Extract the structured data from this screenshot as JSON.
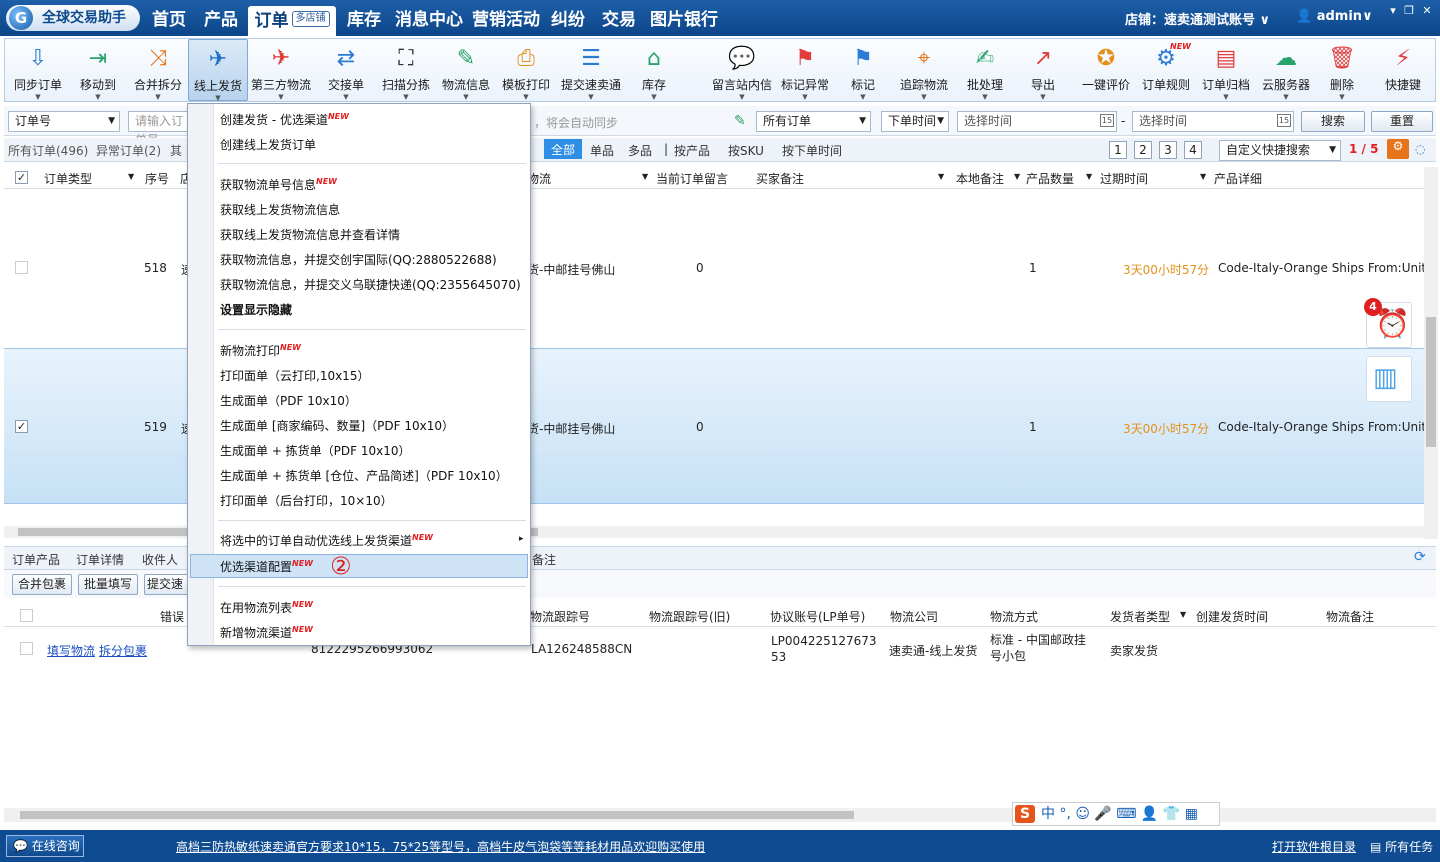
{
  "app": {
    "logo": "全球交易助手",
    "logo_glyph": "G"
  },
  "nav": {
    "items": [
      "首页",
      "产品",
      "订单",
      "库存",
      "消息中心",
      "营销活动",
      "纠纷",
      "交易",
      "图片银行"
    ],
    "order_badge": "多店铺",
    "store_label": "店铺：速卖通测试账号",
    "admin": "admin"
  },
  "toolbar": {
    "items": [
      "同步订单",
      "移动到",
      "合并拆分",
      "线上发货",
      "第三方物流",
      "交接单",
      "扫描分拣",
      "物流信息",
      "模板打印",
      "提交速卖通",
      "库存",
      "留言站内信",
      "标记异常",
      "标记",
      "追踪物流",
      "批处理",
      "导出",
      "一键评价",
      "订单规则",
      "订单归档",
      "云服务器",
      "删除",
      "快捷键"
    ],
    "new_badge": "NEW"
  },
  "filter": {
    "field": "订单号",
    "search_placeholder": "请输入订单号",
    "sync_text": "，将会自动同步",
    "all_orders": "所有订单",
    "order_time": "下单时间",
    "start": "选择时间",
    "dash": "-",
    "end": "选择时间",
    "cal": "15",
    "search_btn": "搜索",
    "reset_btn": "重置"
  },
  "tabs": {
    "all": "所有订单(496)",
    "abnormal": "异常订单(2)",
    "other": "其",
    "t_all": "全部",
    "single": "单品",
    "multi": "多品",
    "sep": "|",
    "by_product": "按产品",
    "by_sku": "按SKU",
    "by_time": "按下单时间",
    "pages": [
      "1",
      "2",
      "3",
      "4"
    ],
    "quick": "自定义快捷搜索",
    "page_info": "1 / 5"
  },
  "grid": {
    "headers": [
      "订单类型",
      "序号",
      "店",
      "物流",
      "当前订单留言",
      "买家备注",
      "本地备注",
      "产品数量",
      "过期时间",
      "产品详细"
    ],
    "rows": [
      {
        "seq": "518",
        "type": "速",
        "logistics": "货-中邮挂号佛山",
        "msg": "0",
        "qty": "1",
        "expire": "3天00小时57分",
        "detail": "Code-Italy-Orange  Ships From:Unit"
      },
      {
        "seq": "519",
        "type": "速",
        "logistics": "货-中邮挂号佛山",
        "msg": "0",
        "qty": "1",
        "expire": "3天00小时57分",
        "detail": "Code-Italy-Orange  Ships From:Unit"
      }
    ]
  },
  "bottom": {
    "tabs": [
      "订单产品",
      "订单详情",
      "收件人",
      "备注"
    ],
    "buttons": [
      "合并包裹",
      "批量填写",
      "提交速卖"
    ],
    "headers": [
      "错误",
      "物流跟踪号",
      "物流跟踪号(旧)",
      "协议账号(LP单号)",
      "物流公司",
      "物流方式",
      "发货者类型",
      "创建发货时间",
      "物流备注"
    ],
    "row": {
      "link1": "填写物流",
      "link2": "拆分包裹",
      "num": "8122295266993062",
      "track": "LA126248588CN",
      "lp": "LP004225127673 53",
      "company": "速卖通-线上发货",
      "method": "标准 - 中国邮政挂号小包",
      "shipper": "卖家发货"
    }
  },
  "dropdown": {
    "items": [
      "创建发货 - 优选渠道",
      "创建线上发货订单",
      "获取物流单号信息",
      "获取线上发货物流信息",
      "获取线上发货物流信息并查看详情",
      "获取物流信息，并提交创宇国际(QQ:2880522688)",
      "获取物流信息，并提交义乌联捷快递(QQ:2355645070)",
      "设置显示隐藏",
      "新物流打印",
      "打印面单（云打印,10x15）",
      "生成面单（PDF 10x10）",
      "生成面单 [商家编码、数量]（PDF 10x10）",
      "生成面单 + 拣货单（PDF 10x10）",
      "生成面单 + 拣货单 [仓位、产品简述]（PDF 10x10）",
      "打印面单（后台打印，10×10）",
      "将选中的订单自动优选线上发货渠道",
      "优选渠道配置",
      "在用物流列表",
      "新增物流渠道"
    ],
    "marker": "②"
  },
  "side": {
    "badge": "4"
  },
  "ime": {
    "text": "中 °, ☺ 🎤 ⌨ 👤 👕 ▦",
    "logo": "S"
  },
  "status": {
    "consult": "在线咨询",
    "ad": "高档三防热敏纸速卖通官方要求10*15，75*25等型号，高档牛皮气泡袋等等耗材用品欢迎购买使用",
    "log": "打开软件根目录",
    "tasks": "所有任务"
  }
}
